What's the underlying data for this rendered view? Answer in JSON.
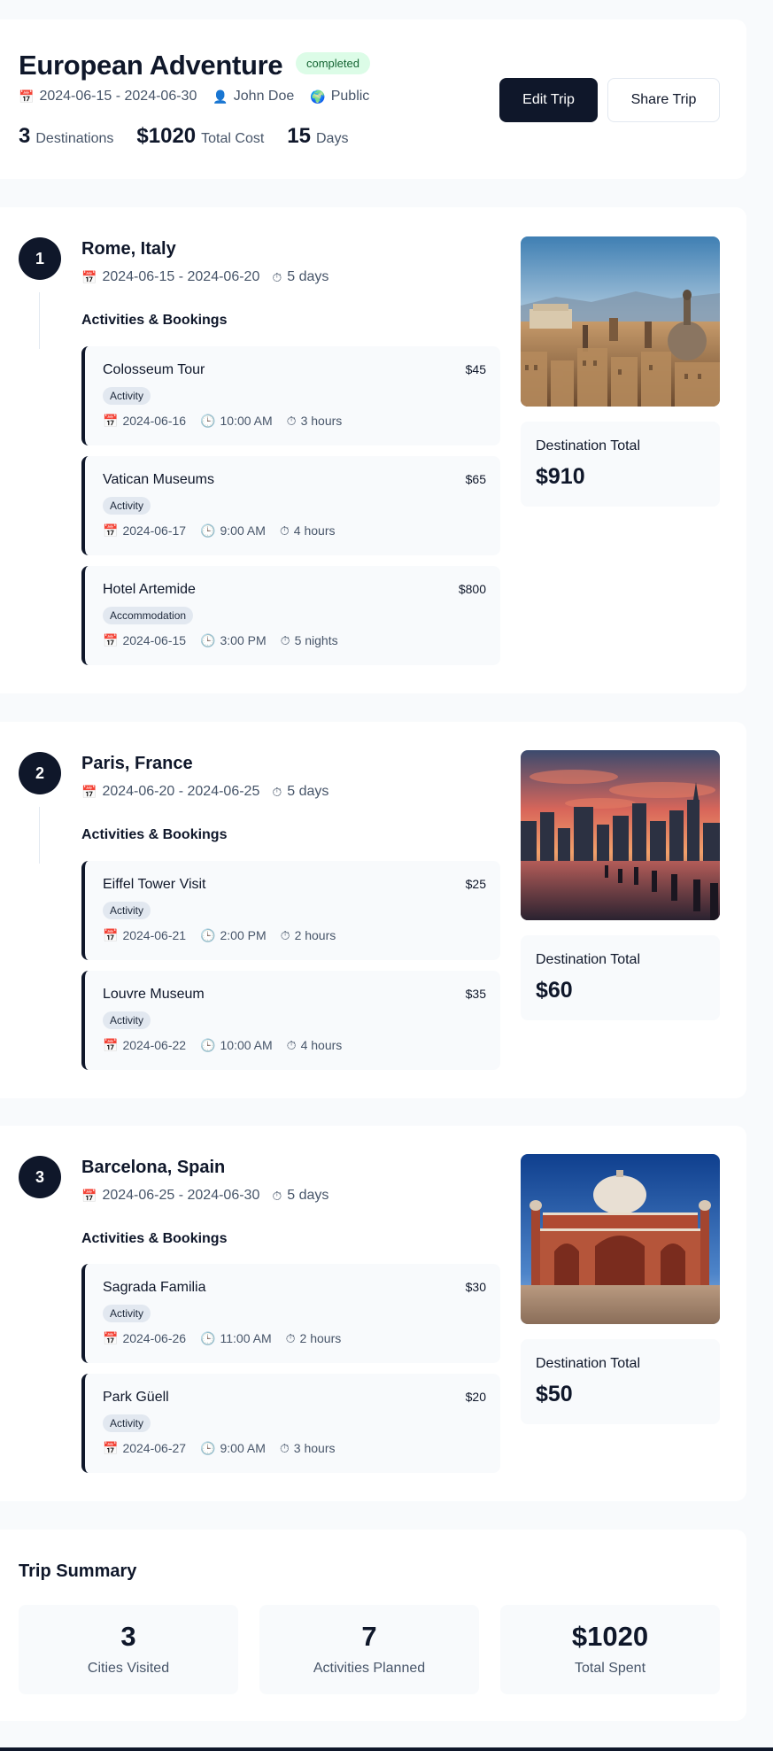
{
  "trip": {
    "title": "European Adventure",
    "status": "completed",
    "dates": "2024-06-15 - 2024-06-30",
    "owner": "John Doe",
    "visibility": "Public",
    "stats": [
      {
        "value": "3",
        "label": "Destinations"
      },
      {
        "value": "$1020",
        "label": "Total Cost"
      },
      {
        "value": "15",
        "label": "Days"
      }
    ],
    "edit_label": "Edit Trip",
    "share_label": "Share Trip"
  },
  "icons": {
    "calendar": "📅",
    "user": "👤",
    "globe": "🌍",
    "clock": "🕒",
    "timer": "⏱"
  },
  "section_label": "Activities & Bookings",
  "total_label": "Destination Total",
  "destinations": [
    {
      "number": "1",
      "name": "Rome, Italy",
      "dates": "2024-06-15 - 2024-06-20",
      "duration": "5 days",
      "total": "$910",
      "activities": [
        {
          "name": "Colosseum Tour",
          "price": "$45",
          "type": "Activity",
          "date": "2024-06-16",
          "time": "10:00 AM",
          "duration": "3 hours"
        },
        {
          "name": "Vatican Museums",
          "price": "$65",
          "type": "Activity",
          "date": "2024-06-17",
          "time": "9:00 AM",
          "duration": "4 hours"
        },
        {
          "name": "Hotel Artemide",
          "price": "$800",
          "type": "Accommodation",
          "date": "2024-06-15",
          "time": "3:00 PM",
          "duration": "5 nights"
        }
      ]
    },
    {
      "number": "2",
      "name": "Paris, France",
      "dates": "2024-06-20 - 2024-06-25",
      "duration": "5 days",
      "total": "$60",
      "activities": [
        {
          "name": "Eiffel Tower Visit",
          "price": "$25",
          "type": "Activity",
          "date": "2024-06-21",
          "time": "2:00 PM",
          "duration": "2 hours"
        },
        {
          "name": "Louvre Museum",
          "price": "$35",
          "type": "Activity",
          "date": "2024-06-22",
          "time": "10:00 AM",
          "duration": "4 hours"
        }
      ]
    },
    {
      "number": "3",
      "name": "Barcelona, Spain",
      "dates": "2024-06-25 - 2024-06-30",
      "duration": "5 days",
      "total": "$50",
      "activities": [
        {
          "name": "Sagrada Familia",
          "price": "$30",
          "type": "Activity",
          "date": "2024-06-26",
          "time": "11:00 AM",
          "duration": "2 hours"
        },
        {
          "name": "Park Güell",
          "price": "$20",
          "type": "Activity",
          "date": "2024-06-27",
          "time": "9:00 AM",
          "duration": "3 hours"
        }
      ]
    }
  ],
  "summary": {
    "title": "Trip Summary",
    "items": [
      {
        "value": "3",
        "label": "Cities Visited"
      },
      {
        "value": "7",
        "label": "Activities Planned"
      },
      {
        "value": "$1020",
        "label": "Total Spent"
      }
    ]
  },
  "colors": {
    "primary": "#0f172a",
    "badge_bg": "#dcfce7",
    "badge_text": "#166534",
    "card_bg": "#ffffff",
    "page_bg": "#f8fafc",
    "muted": "#475569"
  }
}
